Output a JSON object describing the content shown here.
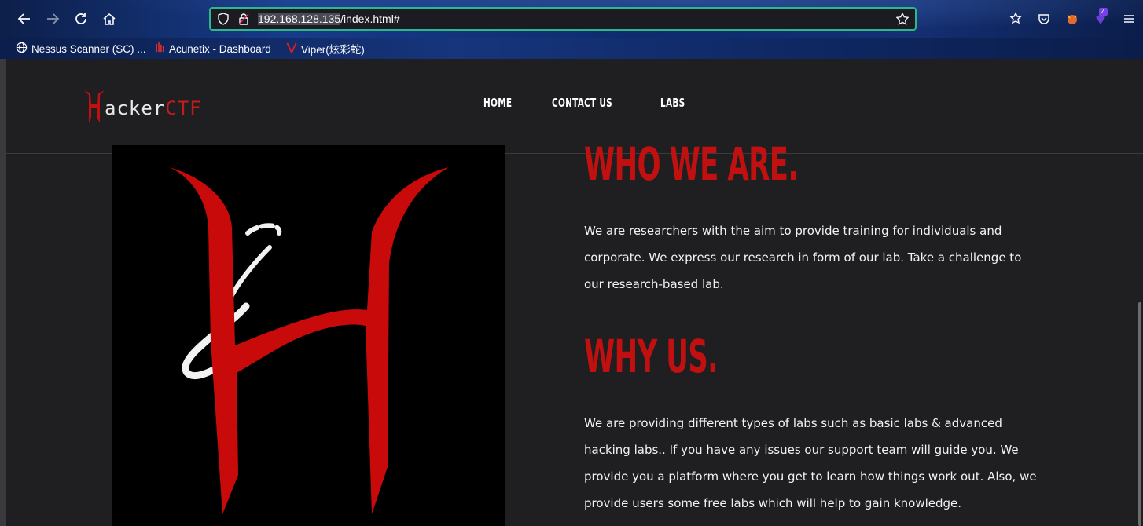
{
  "browser": {
    "url_host": "192.168.128.135",
    "url_path": "/index.html#",
    "extension_badge": "4",
    "bookmarks": [
      {
        "label": "Nessus Scanner (SC) ..."
      },
      {
        "label": "Acunetix - Dashboard"
      },
      {
        "label": "Viper(炫彩蛇)"
      }
    ]
  },
  "site": {
    "logo_word": "acker",
    "logo_ctf": "CTF",
    "nav": [
      "HOME",
      "CONTACT US",
      "LABS"
    ]
  },
  "about": {
    "title": "WHO WE ARE.",
    "text": "We are researchers with the aim to provide training for individuals and corporate. We express our research in form of our lab. Take a challenge to our research-based lab."
  },
  "why": {
    "title": "WHY US.",
    "text": "We are providing different types of labs such as basic labs & advanced hacking labs.. If you have any issues our support team will guide you. We provide you a platform where you get to learn how things work out. Also, we provide users some free labs which will help to gain knowledge."
  },
  "colors": {
    "accent_red": "#c0100f",
    "url_focus": "#2bb88f",
    "page_bg": "#1f1f22"
  }
}
